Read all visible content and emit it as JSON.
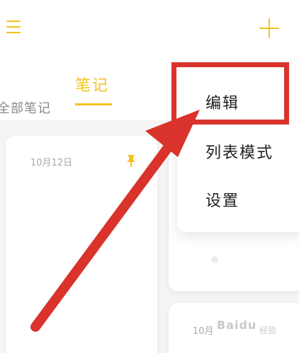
{
  "tabs": {
    "active": "笔记"
  },
  "filter": {
    "label": "全部笔记"
  },
  "cards": [
    {
      "date": "10月12日",
      "pinned": true
    },
    {
      "date": "10月"
    }
  ],
  "menu": {
    "items": [
      {
        "label": "编辑",
        "highlighted": true
      },
      {
        "label": "列表模式"
      },
      {
        "label": "设置"
      }
    ]
  },
  "watermark": {
    "brand": "Baidu",
    "suffix": "经验"
  },
  "colors": {
    "accent": "#f4c21f",
    "annotation": "#d9332b",
    "background": "#f4f4f6",
    "card": "#ffffff"
  },
  "icons": {
    "menu": "hamburger-menu-icon",
    "add": "plus-icon",
    "pin": "pin-icon"
  }
}
